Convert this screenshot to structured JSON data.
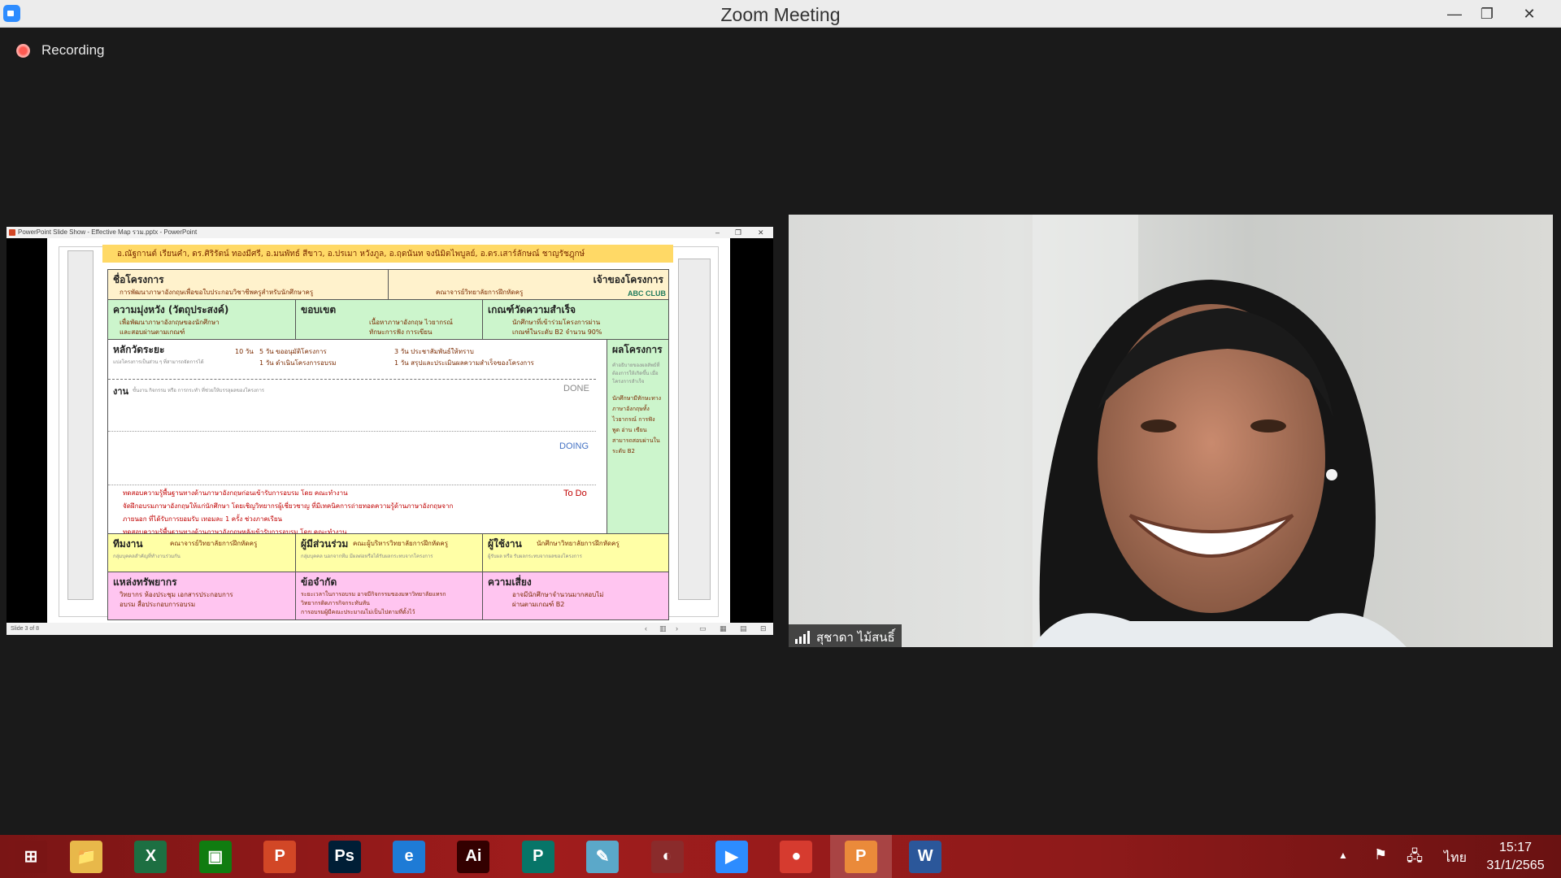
{
  "window": {
    "title": "Zoom Meeting",
    "minimize_glyph": "—",
    "restore_glyph": "❐",
    "close_glyph": "✕"
  },
  "recording": {
    "label": "Recording"
  },
  "share": {
    "ppt_title": "PowerPoint Slide Show - Effective Map รวม.pptx - PowerPoint",
    "status_left": "Slide 3 of 8",
    "slide": {
      "authors": "อ.ณัฐกานต์ เรียนคำ, ดร.ศิริรัตน์ ทองมีศรี, อ.มนพัทธ์ สีขาว, อ.ปรเมา หวังภูล, อ.ฤดนันท จงนิมิตไพบูลย์, อ.ดร.เสาร์ลักษณ์ ชาญรัชฎุกษ์",
      "project_name_h": "ชื่อโครงการ",
      "project_name_t": "การพัฒนาภาษาอังกฤษเพื่อขอใบประกอบวิชาชีพครูสำหรับนักศึกษาครู",
      "owner_h": "เจ้าของโครงการ",
      "owner_t": "คณาจารย์วิทยาลัยการฝึกหัดครู",
      "logo": "ABC CLUB",
      "objective_h": "ความมุ่งหวัง (วัตถุประสงค์)",
      "objective_t1": "เพื่อพัฒนาภาษาอังกฤษของนักศึกษา",
      "objective_t2": "และสอบผ่านตามเกณฑ์",
      "scope_h": "ขอบเขต",
      "scope_t1": "เนื้อหาภาษาอังกฤษ ไวยากรณ์",
      "scope_t2": "ทักษะการฟัง การเขียน",
      "kpi_h": "เกณฑ์วัดความสำเร็จ",
      "kpi_t1": "นักศึกษาที่เข้าร่วมโครงการผ่าน",
      "kpi_t2": "เกณฑ์ในระดับ B2 จำนวน 90%",
      "milestone_h": "หลักวัดระยะ",
      "milestone_s": "แบ่งโครงการเป็นส่วน ๆ ที่สามารถจัดการได้",
      "m1": "10 วัน",
      "m2": "5 วัน ขออนุมัติโครงการ",
      "m3": "1 วัน ดำเนินโครงการอบรม",
      "m4": "3 วัน ประชาสัมพันธ์ให้ทราบ",
      "m5": "1 วัน สรุปและประเมินผลความสำเร็จของโครงการ",
      "result_h": "ผลโครงการ",
      "result_s": "คำอธิบายของผลลัพธ์ที่ต้องการให้เกิดขึ้น เมื่อโครงการสำเร็จ",
      "result_t": "นักศึกษามีทักษะทางภาษาอังกฤษทั้งไวยากรณ์ การฟัง พูด อ่าน เขียน สามารถสอบผ่านในระดับ B2",
      "task_h": "งาน",
      "task_s": "ขั้นงาน กิจกรรม หรือ การกระทำ ที่ช่วยให้บรรลุผลของโครงการ",
      "done": "DONE",
      "doing": "DOING",
      "todo": "To Do",
      "todo1": "ทดสอบความรู้พื้นฐานทางด้านภาษาอังกฤษก่อนเข้ารับการอบรม โดย คณะทำงาน",
      "todo2": "จัดฝึกอบรมภาษาอังกฤษให้แก่นักศึกษา โดยเชิญวิทยากรผู้เชี่ยวชาญ ที่มีเทคนิคการถ่ายทอดความรู้ด้านภาษาอังกฤษจาก",
      "todo3": "ภายนอก ที่ได้รับการยอมรับ เทอมละ 1 ครั้ง ช่วงภาคเรียน",
      "todo4": "ทดสอบความรู้พื้นฐานทางด้านภาษาอังกฤษหลังเข้ารับการอบรม โดย คณะทำงาน",
      "team_h": "ทีมงาน",
      "team_t": "คณาจารย์วิทยาลัยการฝึกหัดครู",
      "team_s": "กลุ่มบุคคลสำคัญที่ทำงานร่วมกัน",
      "stake_h": "ผู้มีส่วนร่วม",
      "stake_t": "คณะผู้บริหารวิทยาลัยการฝึกหัดครู",
      "stake_s": "กลุ่มบุคคล นอกจากทีม มีผลต่อหรือได้รับผลกระทบจากโครงการ",
      "user_h": "ผู้ใช้งาน",
      "user_t": "นักศึกษาวิทยาลัยการฝึกหัดครู",
      "user_s": "ผู้รับผล หรือ รับผลกระทบจากผลของโครงการ",
      "res_h": "แหล่งทรัพยากร",
      "res_t1": "วิทยากร ห้องประชุม เอกสารประกอบการ",
      "res_t2": "อบรม สื่อประกอบการอบรม",
      "const_h": "ข้อจำกัด",
      "const_t1": "ระยะเวลาในการอบรม อาจมีกิจกรรมของมหาวิทยาลัยแทรก",
      "const_t2": "วิทยากรติดภารกิจกระทันหัน",
      "const_t3": "การอบรมผู้มีคณะประมาณไม่เป็นไปตามที่ตั้งไว้",
      "risk_h": "ความเสี่ยง",
      "risk_t1": "อาจมีนักศึกษาจำนวนมากสอบไม่",
      "risk_t2": "ผ่านตามเกณฑ์ B2"
    }
  },
  "participant": {
    "name": "สุชาดา ไม้สนธิ์"
  },
  "taskbar": {
    "apps": [
      {
        "name": "start-button",
        "glyph": "⊞",
        "color": "#7a1515"
      },
      {
        "name": "file-explorer",
        "glyph": "📁",
        "color": "#e8b84a"
      },
      {
        "name": "excel",
        "glyph": "X",
        "color": "#1d6f42"
      },
      {
        "name": "store",
        "glyph": "▣",
        "color": "#107c10"
      },
      {
        "name": "powerpoint",
        "glyph": "P",
        "color": "#d24726"
      },
      {
        "name": "photoshop",
        "glyph": "Ps",
        "color": "#001e36"
      },
      {
        "name": "internet-explorer",
        "glyph": "e",
        "color": "#1e7bd6"
      },
      {
        "name": "illustrator",
        "glyph": "Ai",
        "color": "#330000"
      },
      {
        "name": "publisher",
        "glyph": "P",
        "color": "#077568"
      },
      {
        "name": "notepad",
        "glyph": "✎",
        "color": "#5ba8c9"
      },
      {
        "name": "hotcape",
        "glyph": "◐",
        "color": "#8a2b2b"
      },
      {
        "name": "zoom",
        "glyph": "▶",
        "color": "#2d8cff"
      },
      {
        "name": "chrome",
        "glyph": "●",
        "color": "#d63b2f"
      },
      {
        "name": "powerpoint-active",
        "glyph": "P",
        "color": "#ea8a3a"
      },
      {
        "name": "word",
        "glyph": "W",
        "color": "#2b579a"
      }
    ],
    "language": "ไทย",
    "time": "15:17",
    "date": "31/1/2565"
  }
}
